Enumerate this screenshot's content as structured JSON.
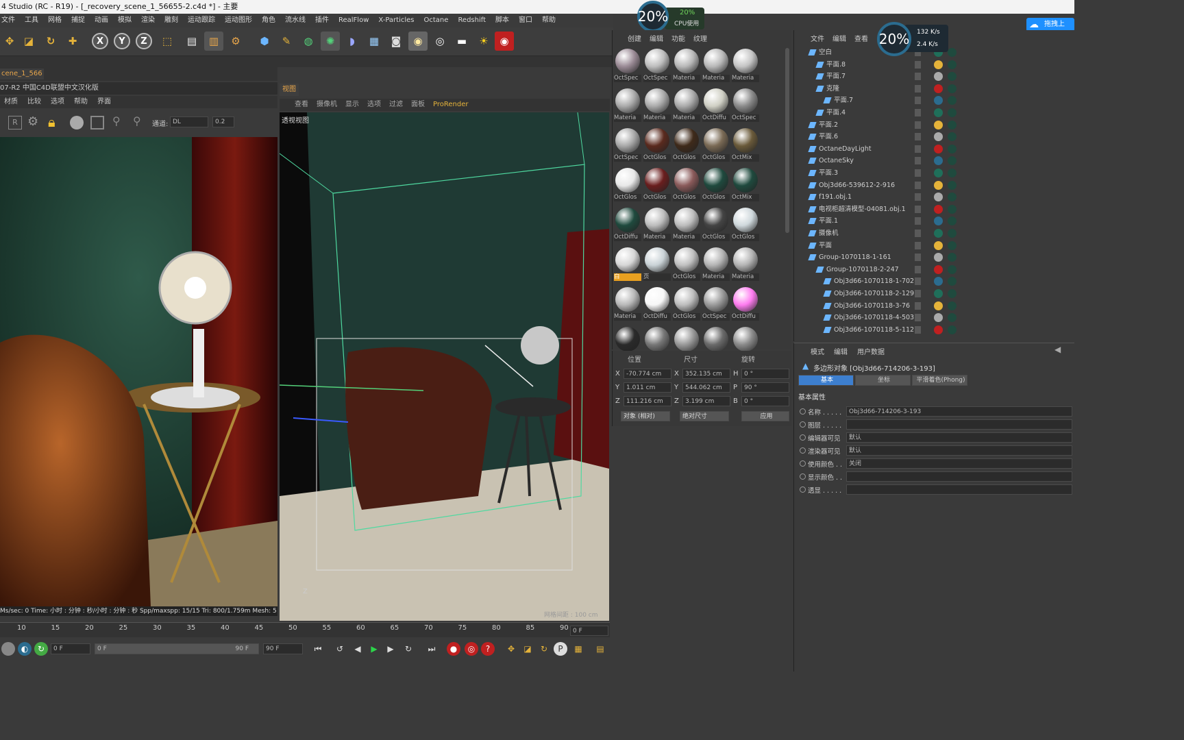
{
  "titlebar": {
    "title": "4 Studio (RC - R19) - [_recovery_scene_1_56655-2.c4d *] - 主要"
  },
  "menubar": [
    "文件",
    "工具",
    "网格",
    "捕捉",
    "动画",
    "模拟",
    "渲染",
    "雕刻",
    "运动跟踪",
    "运动图形",
    "角色",
    "流水线",
    "插件",
    "RealFlow",
    "X-Particles",
    "Octane",
    "Redshift",
    "脚本",
    "窗口",
    "帮助"
  ],
  "toolbar": {
    "x": "X",
    "y": "Y",
    "z": "Z"
  },
  "left_tab": {
    "label": "cene_1_566"
  },
  "picture_viewer": {
    "title": "07-R2 中国C4D联盟中文汉化版",
    "menu": [
      "材质",
      "比较",
      "选项",
      "帮助",
      "界面"
    ],
    "channel_label": "通道:",
    "channel_value": "DL",
    "value": "0.2",
    "status": "Ms/sec: 0   Time: 小时 : 分钟 : 秒/小时 : 分钟 : 秒   Spp/maxspp: 15/15   Tri: 800/1.759m   Mesh: 5"
  },
  "viewport": {
    "tab": "视图",
    "menu": [
      "查看",
      "摄像机",
      "显示",
      "选项",
      "过滤",
      "面板",
      "ProRender"
    ],
    "label": "透视视图",
    "grid_label": "网格间距 : 100 cm",
    "axis_label": "Z"
  },
  "timeline": {
    "ticks": [
      "10",
      "15",
      "20",
      "25",
      "30",
      "35",
      "40",
      "45",
      "50",
      "55",
      "60",
      "65",
      "70",
      "75",
      "80",
      "85",
      "90"
    ],
    "frame": "0 F"
  },
  "playbar": {
    "start": "0 F",
    "slider_start": "0 F",
    "slider_end": "90 F",
    "end": "90 F"
  },
  "cpu_overlay_1": {
    "percent": "20%",
    "sub_percent": "20%",
    "label": "CPU使用"
  },
  "cpu_overlay_2": {
    "percent": "20%",
    "up": "132 K/s",
    "down": "2.4 K/s"
  },
  "top_right_button": "拖拽上",
  "materials": {
    "menu": [
      "创建",
      "编辑",
      "功能",
      "纹理"
    ],
    "items": [
      {
        "label": "OctSpec",
        "color": "#9a8a95"
      },
      {
        "label": "OctSpec",
        "color": "#bdbdbd"
      },
      {
        "label": "Materia",
        "color": "#b8b8b8"
      },
      {
        "label": "Materia",
        "color": "#b8b8b8"
      },
      {
        "label": "Materia",
        "color": "#c4c4c4"
      },
      {
        "label": "Materia",
        "color": "#aaaaaa"
      },
      {
        "label": "Materia",
        "color": "#aaaaaa"
      },
      {
        "label": "Materia",
        "color": "#aaaaaa"
      },
      {
        "label": "OctDiffu",
        "color": "#cfcfc4"
      },
      {
        "label": "OctSpec",
        "color": "#8a8a8a"
      },
      {
        "label": "OctSpec",
        "color": "#a8a8a8"
      },
      {
        "label": "OctGlos",
        "color": "#5a2a1e"
      },
      {
        "label": "OctGlos",
        "color": "#3f2a1a"
      },
      {
        "label": "OctGlos",
        "color": "#7a6a55"
      },
      {
        "label": "OctMix",
        "color": "#6a5a3a"
      },
      {
        "label": "OctGlos",
        "color": "#e8e8e8"
      },
      {
        "label": "OctGlos",
        "color": "#6a1e1e"
      },
      {
        "label": "OctGlos",
        "color": "#8a5a5a"
      },
      {
        "label": "OctGlos",
        "color": "#1f4a3e"
      },
      {
        "label": "OctMix",
        "color": "#1f4a3e"
      },
      {
        "label": "OctDiffu",
        "color": "#1f4a3e"
      },
      {
        "label": "Materia",
        "color": "#bdbdbd"
      },
      {
        "label": "Materia",
        "color": "#bdbdbd"
      },
      {
        "label": "OctGlos",
        "color": "#444444"
      },
      {
        "label": "OctGlos",
        "color": "#cfd8dc"
      },
      {
        "label": "白",
        "color": "#d6d6d6"
      },
      {
        "label": "页",
        "color": "#c9d2d6"
      },
      {
        "label": "OctGlos",
        "color": "#c0c0c0"
      },
      {
        "label": "Materia",
        "color": "#b4b4b4"
      },
      {
        "label": "Materia",
        "color": "#b4b4b4"
      },
      {
        "label": "Materia",
        "color": "#b8b8b8"
      },
      {
        "label": "OctDiffu",
        "color": "#f6f6f6"
      },
      {
        "label": "OctGlos",
        "color": "#bdbdbd"
      },
      {
        "label": "OctSpec",
        "color": "#9a9a9a"
      },
      {
        "label": "OctDiffu",
        "color": "#ff7cf0"
      },
      {
        "label": "",
        "color": "#2a2a2a"
      },
      {
        "label": "",
        "color": "#777777"
      },
      {
        "label": "",
        "color": "#999999"
      },
      {
        "label": "",
        "color": "#6a6a6a"
      },
      {
        "label": "",
        "color": "#8a8a8a"
      }
    ]
  },
  "coordinates": {
    "headers": [
      "位置",
      "尺寸",
      "旋转"
    ],
    "pos": [
      {
        "axis": "X",
        "value": "-70.774 cm"
      },
      {
        "axis": "Y",
        "value": "1.011 cm"
      },
      {
        "axis": "Z",
        "value": "111.216 cm"
      }
    ],
    "size": [
      {
        "axis": "X",
        "value": "352.135 cm"
      },
      {
        "axis": "Y",
        "value": "544.062 cm"
      },
      {
        "axis": "Z",
        "value": "3.199 cm"
      }
    ],
    "rot": [
      {
        "axis": "H",
        "value": "0 °"
      },
      {
        "axis": "P",
        "value": "90 °"
      },
      {
        "axis": "B",
        "value": "0 °"
      }
    ],
    "mode": "对象 (相对)",
    "size_mode": "绝对尺寸",
    "apply": "应用"
  },
  "objects": {
    "menu": [
      "文件",
      "编辑",
      "查看"
    ],
    "items": [
      {
        "name": "空白",
        "indent": 0
      },
      {
        "name": "平面.8",
        "indent": 1
      },
      {
        "name": "平面.7",
        "indent": 1
      },
      {
        "name": "克隆",
        "indent": 1
      },
      {
        "name": "平面.7",
        "indent": 2
      },
      {
        "name": "平面.4",
        "indent": 1
      },
      {
        "name": "平面.2",
        "indent": 0
      },
      {
        "name": "平面.6",
        "indent": 0
      },
      {
        "name": "OctaneDayLight",
        "indent": 0
      },
      {
        "name": "OctaneSky",
        "indent": 0
      },
      {
        "name": "平面.3",
        "indent": 0
      },
      {
        "name": "Obj3d66-539612-2-916",
        "indent": 0
      },
      {
        "name": "f191.obj.1",
        "indent": 0
      },
      {
        "name": "电视柜超清模型-04081.obj.1",
        "indent": 0
      },
      {
        "name": "平面.1",
        "indent": 0
      },
      {
        "name": "摄像机",
        "indent": 0
      },
      {
        "name": "平面",
        "indent": 0
      },
      {
        "name": "Group-1070118-1-161",
        "indent": 0
      },
      {
        "name": "Group-1070118-2-247",
        "indent": 1
      },
      {
        "name": "Obj3d66-1070118-1-702",
        "indent": 2
      },
      {
        "name": "Obj3d66-1070118-2-129",
        "indent": 2
      },
      {
        "name": "Obj3d66-1070118-3-76",
        "indent": 2
      },
      {
        "name": "Obj3d66-1070118-4-503",
        "indent": 2
      },
      {
        "name": "Obj3d66-1070118-5-112",
        "indent": 2
      }
    ]
  },
  "attributes": {
    "menu": [
      "模式",
      "编辑",
      "用户数据"
    ],
    "object_title": "多边形对象 [Obj3d66-714206-3-193]",
    "tabs": [
      "基本",
      "坐标",
      "平滑着色(Phong)"
    ],
    "section": "基本属性",
    "fields": [
      {
        "label": "名称 . . . . .",
        "value": "Obj3d66-714206-3-193"
      },
      {
        "label": "图层 . . . . .",
        "value": ""
      },
      {
        "label": "编辑器可见",
        "value": "默认"
      },
      {
        "label": "渲染器可见",
        "value": "默认"
      },
      {
        "label": "使用颜色 . .",
        "value": "关闭"
      },
      {
        "label": "显示颜色 . .",
        "value": ""
      },
      {
        "label": "透显 . . . . .",
        "value": ""
      }
    ]
  }
}
